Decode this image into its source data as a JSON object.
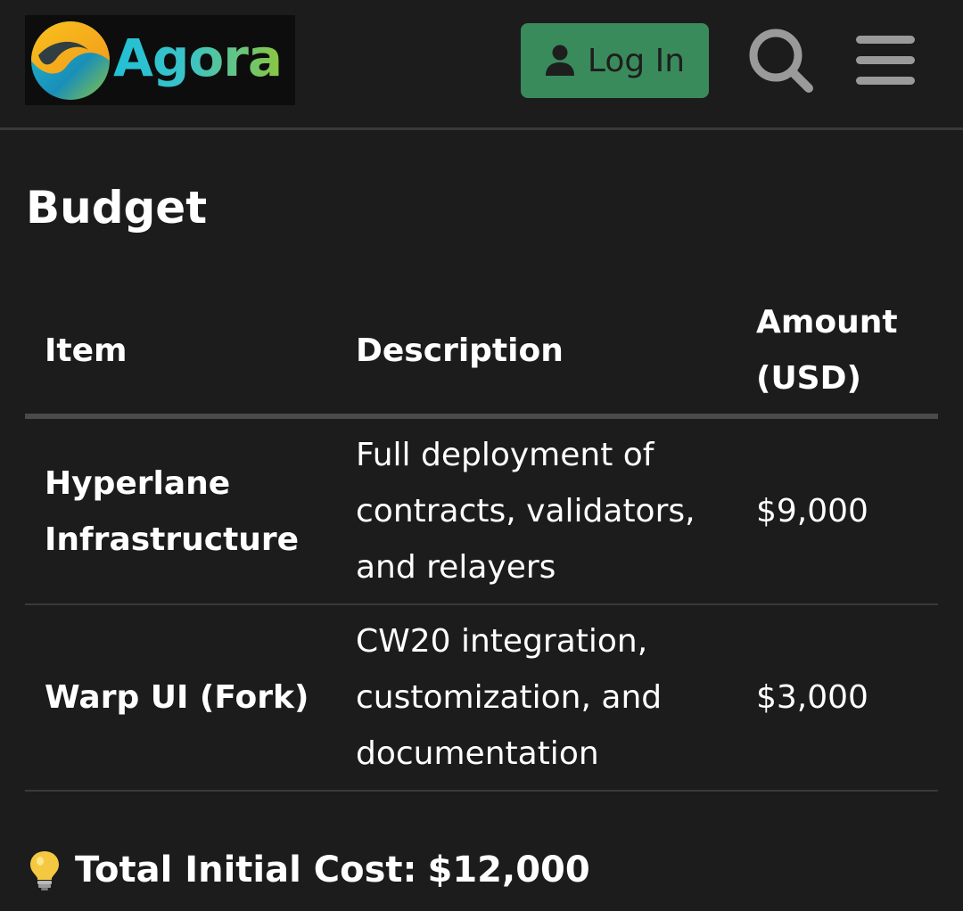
{
  "header": {
    "logo_text": "Agora",
    "login_label": "Log In",
    "icons": {
      "login": "user-icon",
      "search": "search-icon",
      "menu": "hamburger-menu-icon"
    },
    "colors": {
      "login_button": "#3a8b5c",
      "logo_gradient_start": "#21c0d6",
      "logo_gradient_end": "#8cc63f"
    }
  },
  "content": {
    "title": "Budget",
    "table": {
      "headers": {
        "item": "Item",
        "description": "Description",
        "amount_line1": "Amount",
        "amount_line2": "(USD)"
      },
      "rows": [
        {
          "item_line1": "Hyperlane",
          "item_line2": "Infrastructure",
          "desc_line1": "Full deployment of",
          "desc_line2": "contracts, validators,",
          "desc_line3": "and relayers",
          "amount": "$9,000"
        },
        {
          "item_line1": "Warp UI (Fork)",
          "item_line2": "",
          "desc_line1": "CW20 integration,",
          "desc_line2": "customization, and",
          "desc_line3": "documentation",
          "amount": "$3,000"
        }
      ]
    },
    "total": {
      "icon": "lightbulb-icon",
      "label": "Total Initial Cost:",
      "value": "$12,000"
    }
  }
}
